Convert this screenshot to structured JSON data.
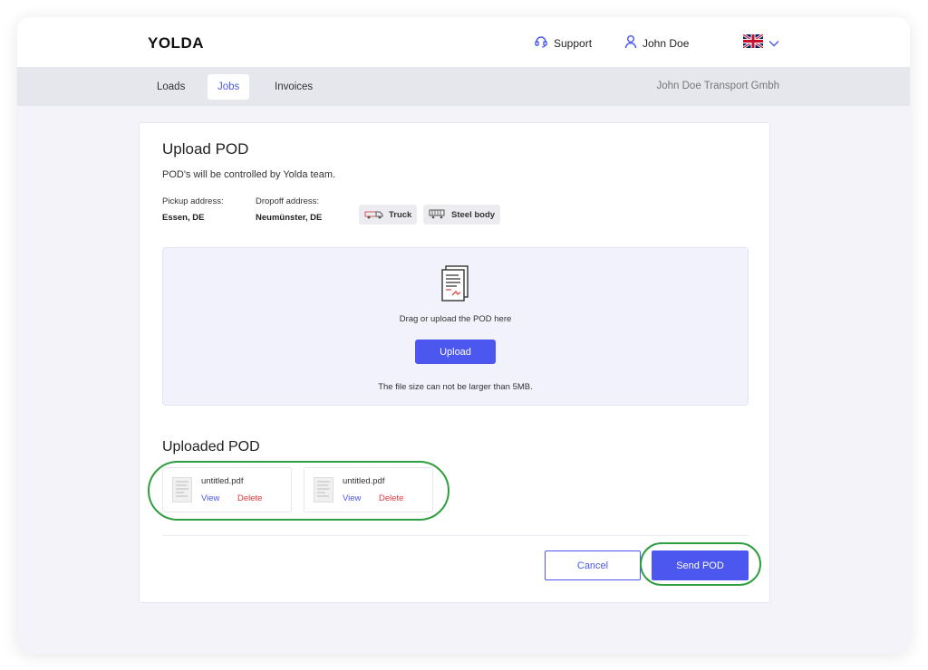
{
  "header": {
    "logo": "YOLDA",
    "support_label": "Support",
    "user_name": "John Doe",
    "language_flag": "uk-flag-icon"
  },
  "nav": {
    "tabs": [
      {
        "label": "Loads",
        "active": false
      },
      {
        "label": "Jobs",
        "active": true
      },
      {
        "label": "Invoices",
        "active": false
      }
    ],
    "company": "John Doe Transport Gmbh"
  },
  "upload_pod": {
    "title": "Upload POD",
    "subtitle": "POD's will be controlled by Yolda team.",
    "pickup_label": "Pickup address:",
    "pickup_value": "Essen, DE",
    "dropoff_label": "Dropoff address:",
    "dropoff_value": "Neumünster, DE",
    "vehicle_chip": "Truck",
    "body_chip": "Steel body",
    "dropzone_text": "Drag or upload the POD here",
    "upload_button": "Upload",
    "size_note": "The file size can not be larger than 5MB."
  },
  "uploaded_pod": {
    "title": "Uploaded POD",
    "files": [
      {
        "name": "untitled.pdf",
        "view_label": "View",
        "delete_label": "Delete"
      },
      {
        "name": "untitled.pdf",
        "view_label": "View",
        "delete_label": "Delete"
      }
    ]
  },
  "actions": {
    "cancel_label": "Cancel",
    "send_label": "Send POD"
  },
  "colors": {
    "accent": "#4b57ee",
    "danger": "#e0353b",
    "highlight": "#2f9e3f"
  }
}
